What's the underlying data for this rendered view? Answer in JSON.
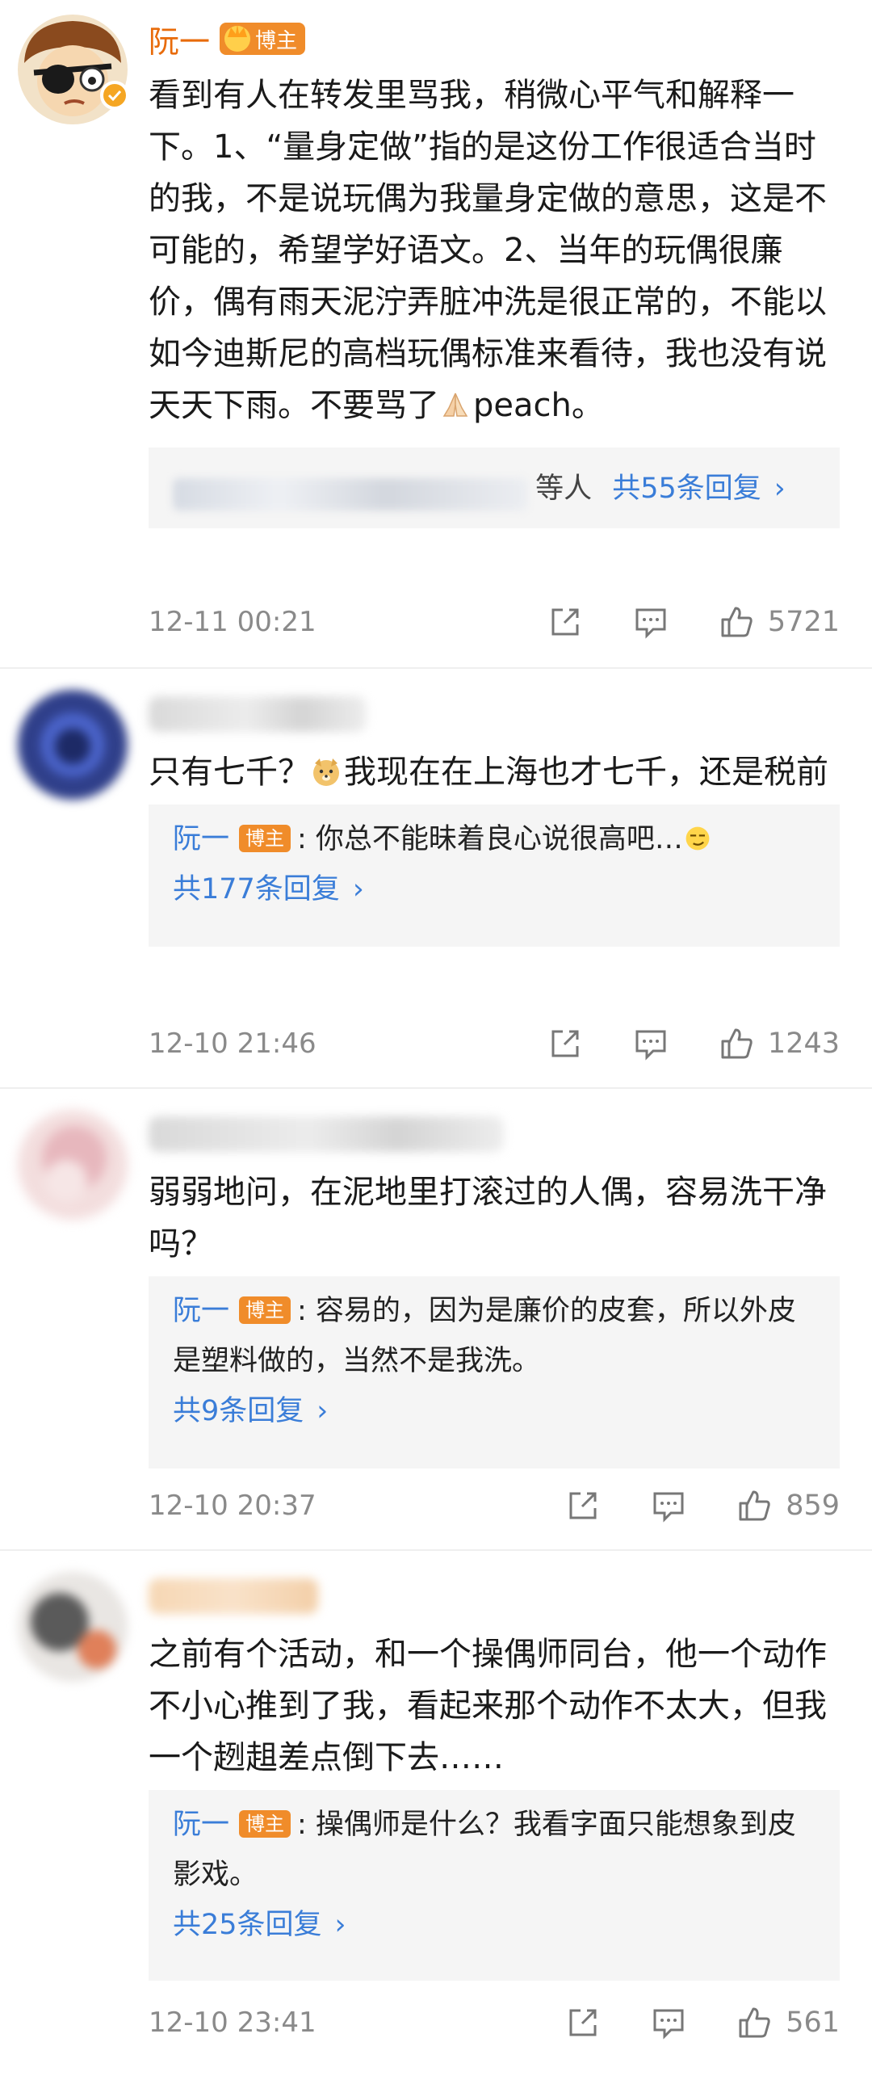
{
  "comments": [
    {
      "name": "阮一",
      "badge": "博主",
      "text": "看到有人在转发里骂我，稍微心平气和解释一下。1、“量身定做”指的是这份工作很适合当时的我，不是说玩偶为我量身定做的意思，这是不可能的，希望学好语文。2、当年的玩偶很廉价，偶有雨天泥泞弄脏冲洗是很正常的，不能以如今迪斯尼的高档玩偶标准来看待，我也没有说天天下雨。不要骂了",
      "text_tail": "peach。",
      "reply_suffix": "等人",
      "reply_more": "共55条回复",
      "time": "12-11 00:21",
      "likes": "5721"
    },
    {
      "text": "只有七千？",
      "text_tail": "我现在在上海也才七千，还是税前",
      "reply": {
        "name": "阮一",
        "badge": "博主",
        "text": ": 你总不能昧着良心说很高吧…"
      },
      "reply_more": "共177条回复",
      "time": "12-10 21:46",
      "likes": "1243"
    },
    {
      "text": "弱弱地问，在泥地里打滚过的人偶，容易洗干净吗？",
      "reply": {
        "name": "阮一",
        "badge": "博主",
        "text": ": 容易的，因为是廉价的皮套，所以外皮是塑料做的，当然不是我洗。"
      },
      "reply_more": "共9条回复",
      "time": "12-10 20:37",
      "likes": "859"
    },
    {
      "text": "之前有个活动，和一个操偶师同台，他一个动作不小心推到了我，看起来那个动作不太大，但我一个趔趄差点倒下去……",
      "reply": {
        "name": "阮一",
        "badge": "博主",
        "text": ": 操偶师是什么？我看字面只能想象到皮影戏。"
      },
      "reply_more": "共25条回复",
      "time": "12-10 23:41",
      "likes": "561"
    }
  ],
  "icons": {
    "share": "share-icon",
    "comment": "comment-icon",
    "like": "thumbs-up-icon",
    "chevron": "chevron-right-icon"
  },
  "colors": {
    "name": "#e86b0a",
    "link": "#3a7dd8",
    "badge": "#f08c2a",
    "meta": "#8a8a8a"
  }
}
